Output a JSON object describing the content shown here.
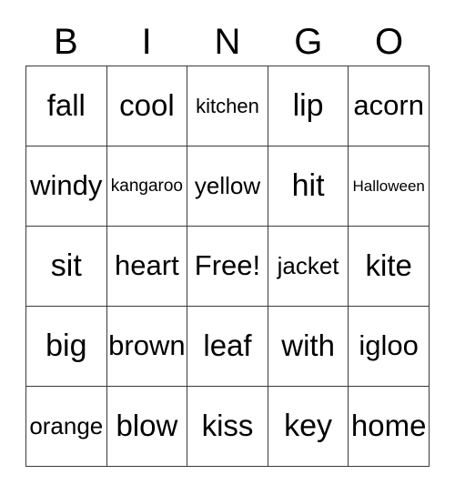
{
  "card": {
    "title_letters": [
      "B",
      "I",
      "N",
      "G",
      "O"
    ],
    "rows": [
      [
        "fall",
        "cool",
        "kitchen",
        "lip",
        "acorn"
      ],
      [
        "windy",
        "kangaroo",
        "yellow",
        "hit",
        "Halloween"
      ],
      [
        "sit",
        "heart",
        "Free!",
        "jacket",
        "kite"
      ],
      [
        "big",
        "brown",
        "leaf",
        "with",
        "igloo"
      ],
      [
        "orange",
        "blow",
        "kiss",
        "key",
        "home"
      ]
    ],
    "free_space": "Free!",
    "colors": {
      "border": "#3a3a3a",
      "text": "#000000",
      "background": "#ffffff"
    }
  }
}
